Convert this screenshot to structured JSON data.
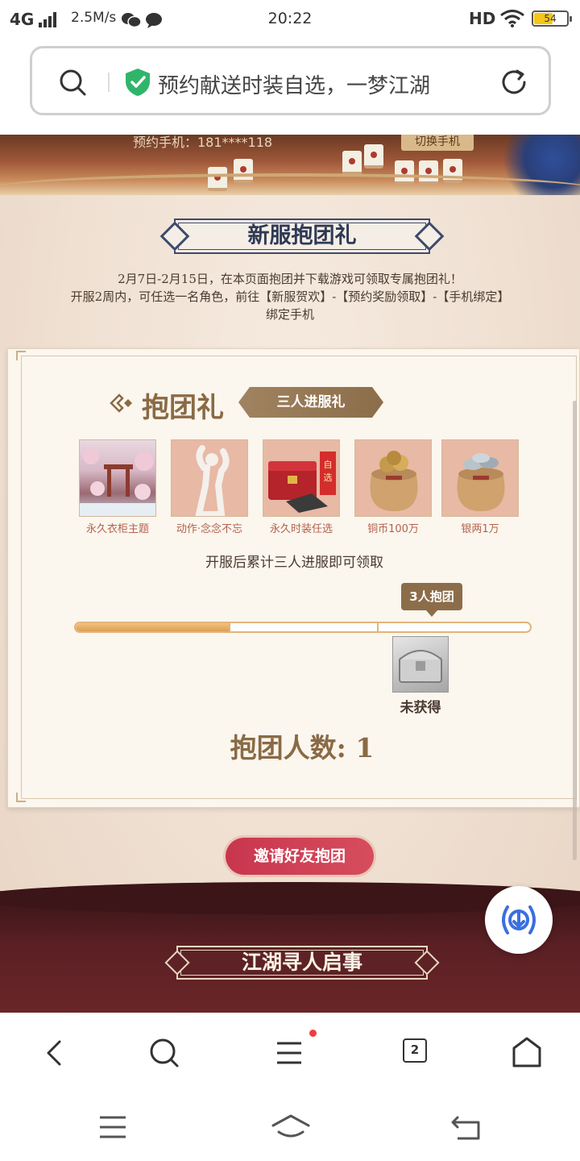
{
  "status_bar": {
    "network": "4G",
    "speed": "2.5M/s",
    "time": "20:22",
    "hd": "HD",
    "battery": "54"
  },
  "address_bar": {
    "url_text": "预约献送时装自选，一梦江湖"
  },
  "banner": {
    "phone_label": "预约手机：181****118",
    "switch_button": "切换手机"
  },
  "section": {
    "title": "新服抱团礼",
    "description_lines": [
      "2月7日-2月15日，在本页面抱团并下载游戏可领取专属抱团礼！",
      "开服2周内，可任选一名角色，前往【新服贺欢】-【预约奖励领取】-【手机绑定】",
      "绑定手机"
    ]
  },
  "card": {
    "gift_title": "抱团礼",
    "tag": "三人进服礼",
    "rewards": [
      {
        "label": "永久衣柜主题",
        "icon": "wardrobe-theme-icon"
      },
      {
        "label": "动作·念念不忘",
        "icon": "action-pose-icon"
      },
      {
        "label": "永久时装任选",
        "icon": "fashion-chest-icon"
      },
      {
        "label": "铜币100万",
        "icon": "copper-coin-bag-icon"
      },
      {
        "label": "银两1万",
        "icon": "silver-bag-icon"
      }
    ],
    "claim_note": "开服后累计三人进服即可领取",
    "milestone_label": "3人抱团",
    "progress_fraction": 0.34,
    "chest_status": "未获得",
    "count_label": "抱团人数: 1"
  },
  "invite_button": "邀请好友抱团",
  "next_section_title": "江湖寻人启事",
  "toolbar": {
    "tabs_count": "2"
  },
  "colors": {
    "accent_brown": "#8a6a45",
    "invite_red": "#c8364e",
    "shield_green": "#2fb56a",
    "download_blue": "#3b6fe0"
  }
}
